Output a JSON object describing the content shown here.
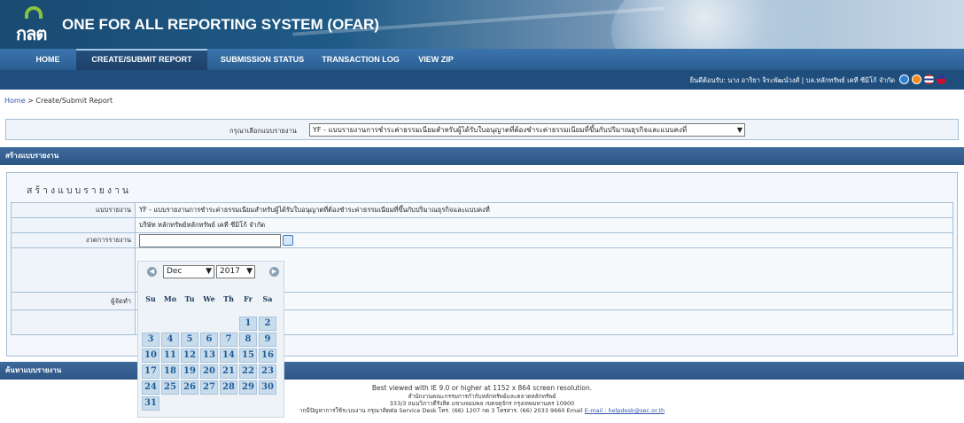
{
  "header": {
    "logo_text": "กลต",
    "title": "ONE FOR ALL REPORTING SYSTEM (OFAR)"
  },
  "nav": {
    "items": [
      "HOME",
      "CREATE/SUBMIT REPORT",
      "SUBMISSION STATUS",
      "TRANSACTION LOG",
      "VIEW ZIP"
    ],
    "active": "CREATE/SUBMIT REPORT"
  },
  "userbar": {
    "welcome": "ยินดีต้อนรับ: นาง อาริยา จิระพัฒน์วงศ์ | บล.หลักทรัพย์ เคที ซีมิโก้ จำกัด",
    "icons": [
      "info-icon",
      "power-icon",
      "thai-flag-icon",
      "us-flag-icon"
    ]
  },
  "breadcrumb": {
    "home": "Home",
    "sep": ">",
    "current": "Create/Submit Report"
  },
  "report_select": {
    "label": "กรุณาเลือกแบบรายงาน",
    "value": "YF - แบบรายงานการชำระค่าธรรมเนียมสำหรับผู้ได้รับใบอนุญาตที่ต้องชำระค่าธรรมเนียมที่ขึ้นกับปริมาณธุรกิจและแบบคงที่"
  },
  "create_section": {
    "bar_title": "สร้างแบบรายงาน",
    "panel_title": "สร้างแบบรายงาน",
    "rows": [
      {
        "label": "แบบรายงาน",
        "value": "YF - แบบรายงานการชำระค่าธรรมเนียมสำหรับผู้ได้รับใบอนุญาตที่ต้องชำระค่าธรรมเนียมที่ขึ้นกับปริมาณธุรกิจและแบบคงที่"
      },
      {
        "label": "",
        "value": "บริษัท หลักทรัพย์หลักทรัพย์ เคที ซีมิโก้ จำกัด"
      },
      {
        "label": "งวดการรายงาน",
        "value": ""
      },
      {
        "label": "",
        "value": ""
      },
      {
        "label": "ผู้จัดทำ",
        "value": ""
      },
      {
        "label": "",
        "value": ""
      }
    ]
  },
  "calendar": {
    "month": "Dec",
    "year": "2017",
    "weekdays": [
      "Su",
      "Mo",
      "Tu",
      "We",
      "Th",
      "Fr",
      "Sa"
    ],
    "days": [
      "1",
      "2",
      "3",
      "4",
      "5",
      "6",
      "7",
      "8",
      "9",
      "10",
      "11",
      "12",
      "13",
      "14",
      "15",
      "16",
      "17",
      "18",
      "19",
      "20",
      "21",
      "22",
      "23",
      "24",
      "25",
      "26",
      "27",
      "28",
      "29",
      "30",
      "31"
    ],
    "first_weekday": 5
  },
  "search_section": {
    "bar_title": "ค้นหาแบบรายงาน"
  },
  "footer": {
    "line1": "Best viewed with IE 9.0 or higher at 1152 x 864 screen resolution.",
    "line2": "สำนักงานคณะกรรมการกำกับหลักทรัพย์และตลาดหลักทรัพย์",
    "line3": "333/3 ถนนวิภาวดีรังสิต แขวงจอมพล เขตจตุจักร กรุงเทพมหานคร 10900",
    "line4_prefix": "ากมีปัญหาการใช้ระบบงาน กรุณาติดต่อ Service Desk โทร. (66) 1207 กด 3 โทรสาร. (66) 2033 9660 Email",
    "email": "E-mail : helpdesk@sec.or.th"
  }
}
